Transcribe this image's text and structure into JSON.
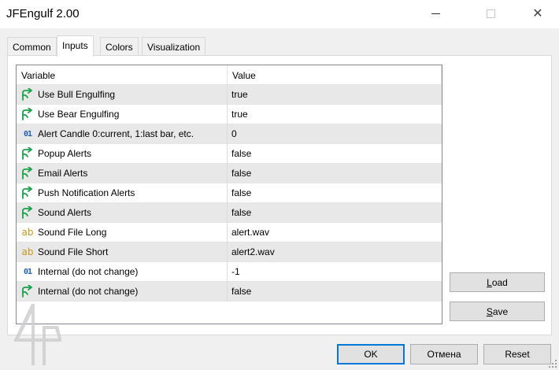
{
  "window": {
    "title": "JFEngulf 2.00",
    "minimize_icon": "minimize-icon",
    "maximize_icon": "maximize-icon",
    "close_icon": "close-icon",
    "close_glyph": "✕"
  },
  "tabs": [
    {
      "label": "Common",
      "active": false
    },
    {
      "label": "Inputs",
      "active": true
    },
    {
      "label": "Colors",
      "active": false
    },
    {
      "label": "Visualization",
      "active": false
    }
  ],
  "table": {
    "headers": {
      "variable": "Variable",
      "value": "Value"
    },
    "rows": [
      {
        "icon": "bool-arrow-icon",
        "variable": "Use Bull Engulfing",
        "value": "true"
      },
      {
        "icon": "bool-arrow-icon",
        "variable": "Use Bear Engulfing",
        "value": "true"
      },
      {
        "icon": "integer-icon",
        "icon_text": "01",
        "variable": "Alert Candle 0:current, 1:last bar, etc.",
        "value": "0"
      },
      {
        "icon": "bool-arrow-icon",
        "variable": "Popup Alerts",
        "value": "false"
      },
      {
        "icon": "bool-arrow-icon",
        "variable": "Email Alerts",
        "value": "false"
      },
      {
        "icon": "bool-arrow-icon",
        "variable": "Push Notification Alerts",
        "value": "false"
      },
      {
        "icon": "bool-arrow-icon",
        "variable": "Sound Alerts",
        "value": "false"
      },
      {
        "icon": "string-icon",
        "icon_text": "ab",
        "variable": "Sound File Long",
        "value": "alert.wav"
      },
      {
        "icon": "string-icon",
        "icon_text": "ab",
        "variable": "Sound File Short",
        "value": "alert2.wav"
      },
      {
        "icon": "integer-icon",
        "icon_text": "01",
        "variable": "Internal (do not change)",
        "value": "-1"
      },
      {
        "icon": "bool-arrow-icon",
        "variable": "Internal (do not change)",
        "value": "false"
      }
    ]
  },
  "buttons": {
    "load": {
      "first": "L",
      "rest": "oad"
    },
    "save": {
      "first": "S",
      "rest": "ave"
    },
    "ok": "OK",
    "cancel": "Отмена",
    "reset": "Reset"
  },
  "colors": {
    "accent": "#0078d7",
    "bool_icon": "#1aa34a",
    "int_icon": "#1c5dbd",
    "string_icon": "#c8961c"
  }
}
